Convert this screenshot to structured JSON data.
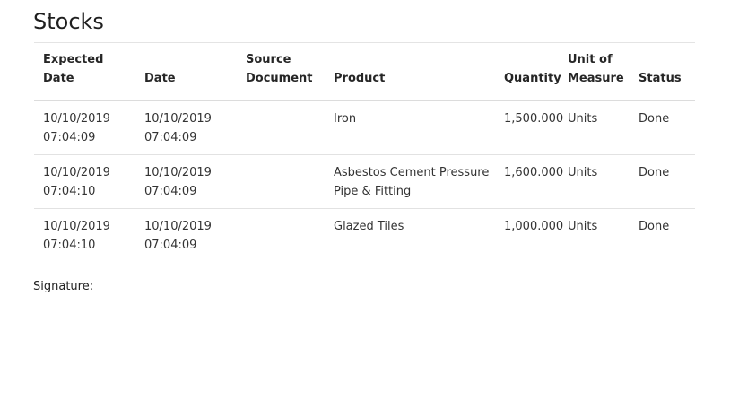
{
  "page": {
    "title": "Stocks"
  },
  "table": {
    "headers": {
      "expected_date": "Expected Date",
      "date": "Date",
      "source_document_line1": "Source",
      "source_document_line2": "Document",
      "product": "Product",
      "quantity": "Quantity",
      "uom_line1": "Unit of",
      "uom_line2": "Measure",
      "status": "Status"
    },
    "rows": [
      {
        "expected_date": "10/10/2019",
        "expected_time": "07:04:09",
        "date": "10/10/2019",
        "time": "07:04:09",
        "source_document": "",
        "product": "Iron",
        "quantity": "1,500.000",
        "uom": "Units",
        "status": "Done"
      },
      {
        "expected_date": "10/10/2019",
        "expected_time": "07:04:10",
        "date": "10/10/2019",
        "time": "07:04:09",
        "source_document": "",
        "product": "Asbestos Cement Pressure Pipe & Fitting",
        "quantity": "1,600.000",
        "uom": "Units",
        "status": "Done"
      },
      {
        "expected_date": "10/10/2019",
        "expected_time": "07:04:10",
        "date": "10/10/2019",
        "time": "07:04:09",
        "source_document": "",
        "product": "Glazed Tiles",
        "quantity": "1,000.000",
        "uom": "Units",
        "status": "Done"
      }
    ]
  },
  "signature": {
    "label": "Signature:_______________"
  }
}
